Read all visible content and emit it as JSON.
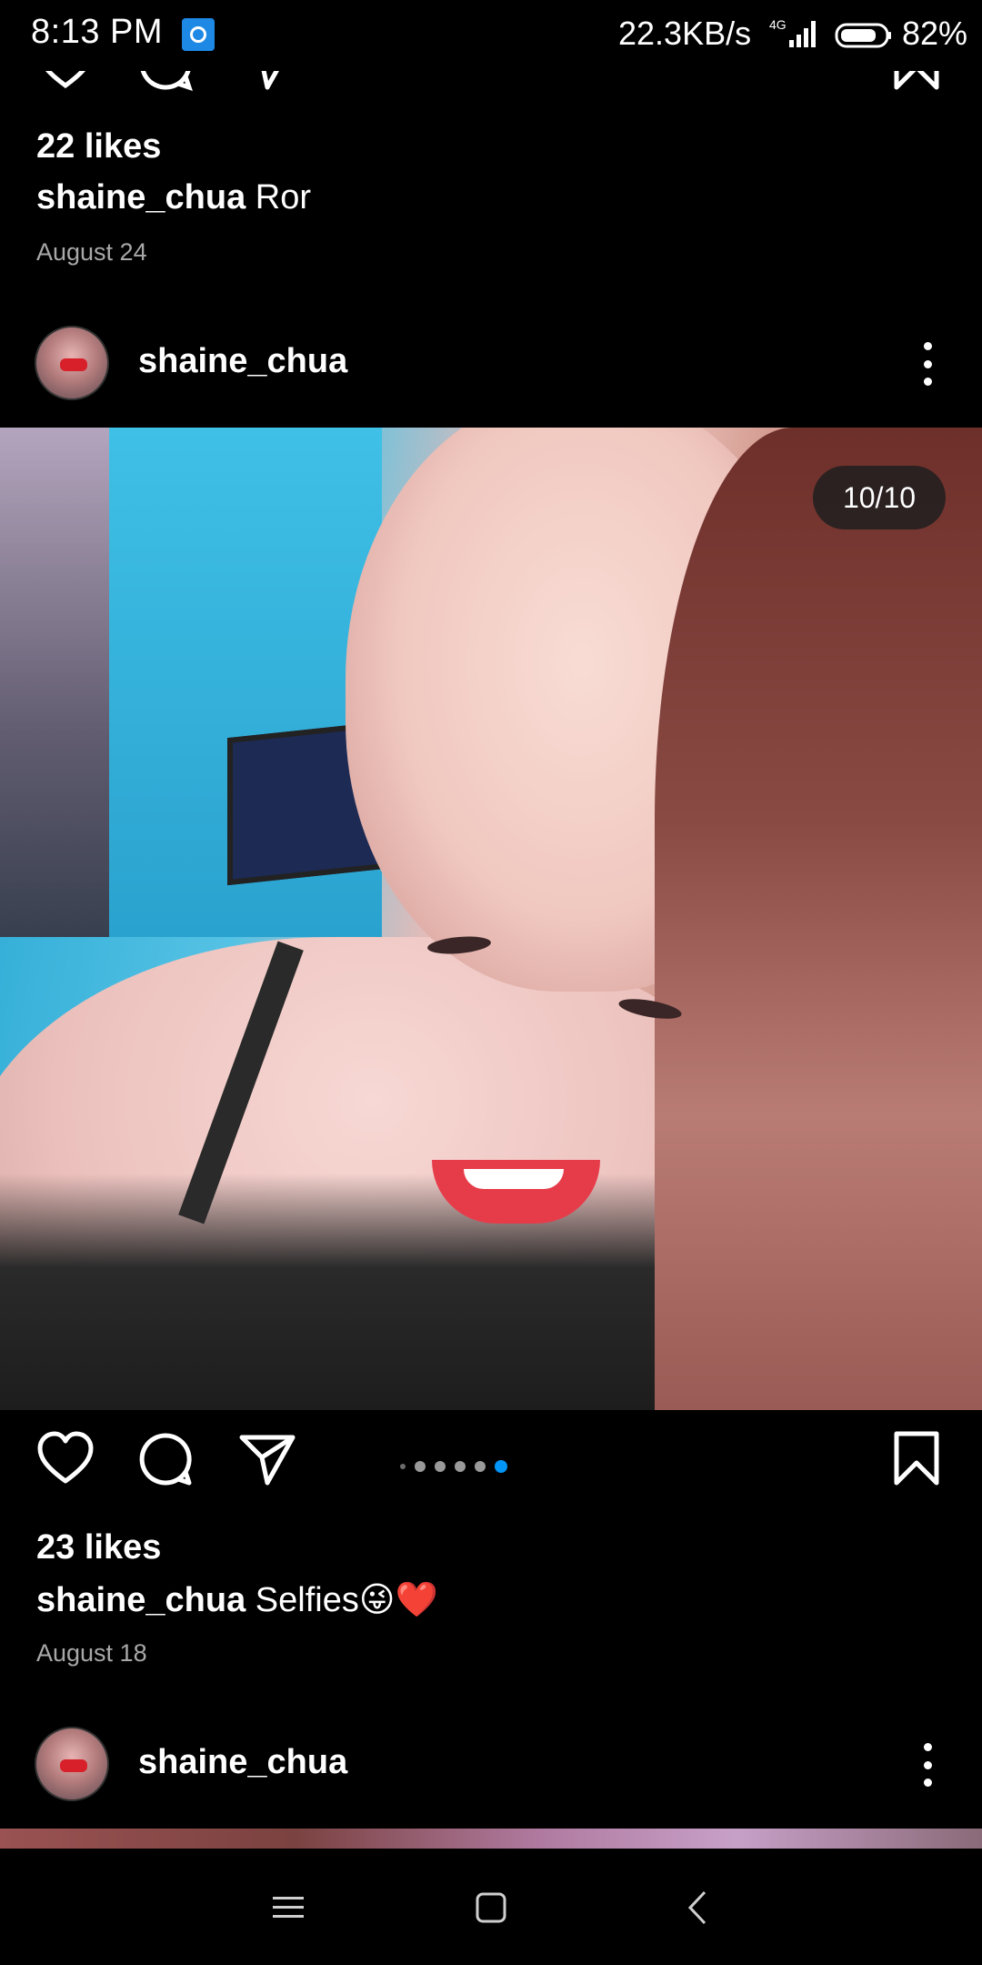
{
  "status_bar": {
    "time": "8:13 PM",
    "network_speed": "22.3KB/s",
    "network_type": "4G",
    "battery_percent": "82%",
    "battery_level": 0.82,
    "app_icon": "mi-app-icon"
  },
  "posts": [
    {
      "likes": "22 likes",
      "username": "shaine_chua",
      "caption": "Ror",
      "date": "August 24"
    },
    {
      "username": "shaine_chua",
      "image_counter": "10/10",
      "carousel_dot_count": 6,
      "carousel_active_index": 5,
      "likes": "23 likes",
      "caption": "Selfies😜❤️",
      "date": "August 18"
    },
    {
      "username": "shaine_chua"
    }
  ],
  "icons": {
    "like": "heart-outline-icon",
    "comment": "speech-bubble-icon",
    "share": "paper-plane-icon",
    "save": "bookmark-outline-icon",
    "more": "vertical-ellipsis-icon"
  },
  "colors": {
    "background": "#000000",
    "text": "#ffffff",
    "muted_text": "#a8a8a8",
    "active_dot": "#0095f6",
    "inactive_dot": "#9a9a9a"
  },
  "nav_bar": {
    "menu": "menu-icon",
    "home": "home-square-icon",
    "back": "back-chevron-icon"
  }
}
